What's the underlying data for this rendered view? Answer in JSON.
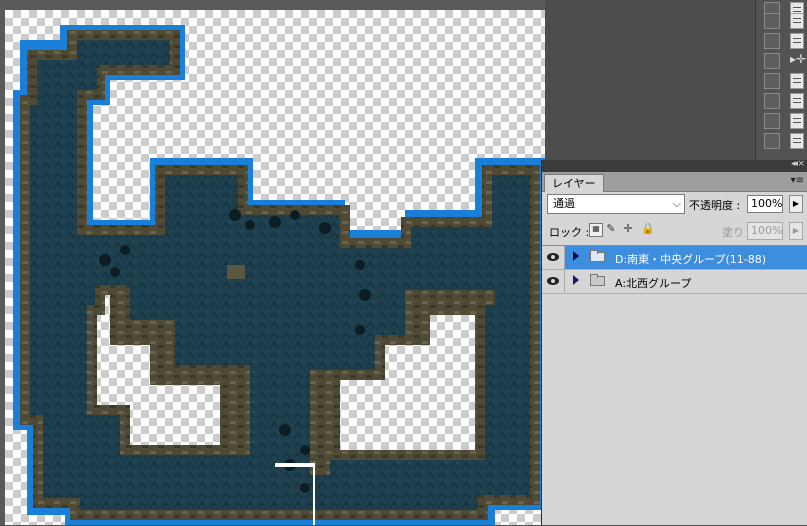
{
  "layers_panel": {
    "tab_label": "レイヤー",
    "blend_mode": "通過",
    "opacity_label": "不透明度 :",
    "opacity_value": "100%",
    "lock_label": "ロック :",
    "fill_label": "塗り :",
    "fill_value": "100%",
    "layers": [
      {
        "name": "D:南東・中央グループ(11-88)",
        "visible": true,
        "selected": true,
        "type": "group"
      },
      {
        "name": "A:北西グループ",
        "visible": true,
        "selected": false,
        "type": "group"
      }
    ]
  },
  "icons": {
    "eye": "eye-icon",
    "folder": "folder-icon",
    "expand": "expand-triangle-icon",
    "lock_transparent": "lock-transparent-icon",
    "lock_brush": "brush-icon",
    "lock_move": "move-icon",
    "lock_all": "lock-icon",
    "panel_menu": "panel-menu-icon",
    "collapse": "collapse-icon"
  },
  "colors": {
    "selection_blue": "#3e8ee0",
    "map_water": "#1a7fd9",
    "map_wall": "#4f4a36",
    "map_floor": "#1d3f4e"
  }
}
